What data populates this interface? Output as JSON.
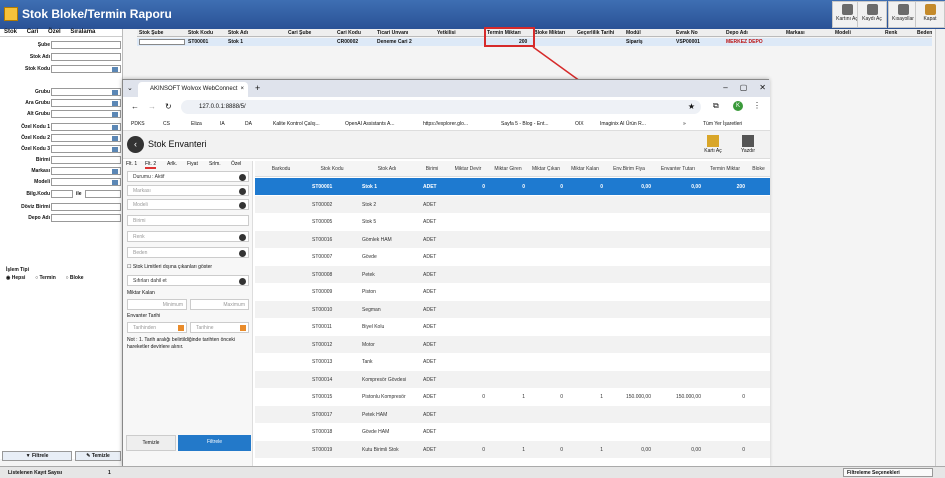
{
  "app": {
    "title": "Stok Bloke/Termin Raporu"
  },
  "toolbar": {
    "kartini_ac": "Kartını Aç",
    "kaydi_ac": "Kaydı Aç",
    "kisayollar": "Kısayollar",
    "kapat": "Kapat"
  },
  "left_panel": {
    "tabs": [
      "Stok",
      "Cari",
      "Özel",
      "Sıralama"
    ],
    "fields": [
      "Şube",
      "Stok Adı",
      "Stok Kodu",
      "Grubu",
      "Ara Grubu",
      "Alt Grubu",
      "Özel Kodu 1",
      "Özel Kodu 2",
      "Özel Kodu 3",
      "Birimi",
      "Markası",
      "Modeli",
      "Bilg.Kodu",
      "Döviz Birimi",
      "Depo Adı"
    ],
    "ile_label": "ile",
    "islem_tipi_label": "İşlem Tipi",
    "radio": [
      "Hepsi",
      "Termin",
      "Bloke"
    ],
    "filtrele": "Filtrele",
    "temizle": "Temizle"
  },
  "status": {
    "listed_label": "Listelenen Kayıt Sayısı",
    "listed_count": "1",
    "filtre_secenekleri": "Filtreleme Seçenekleri"
  },
  "grid": {
    "headers": [
      "Stok Şube",
      "Stok Kodu",
      "Stok Adı",
      "Cari Şube",
      "Cari Kodu",
      "Ticari Unvanı",
      "Yetkilisi",
      "Termin Miktarı",
      "Bloke Miktarı",
      "Geçerlilik Tarihi",
      "Modül",
      "Evrak No",
      "Depo Adı",
      "Markası",
      "Modeli",
      "Renk",
      "Beden"
    ],
    "row": {
      "stok_kodu": "ST00001",
      "stok_adi": "Stok 1",
      "cari_kodu": "CR00002",
      "ticari_unvan": "Deneme Cari 2",
      "termin_miktari": "200",
      "modul": "Sipariş",
      "evrak_no": "VSP00001",
      "depo_adi": "MERKEZ DEPO"
    }
  },
  "browser": {
    "tab_title": "AKINSOFT Wolvox WebConnect",
    "url": "127.0.0.1:8888/5/",
    "profile_initial": "K",
    "bookmarks": [
      "PDKS",
      "CS",
      "Eliza",
      "IA",
      "DA",
      "Kalite Kontrol Çalış...",
      "OpenAI Assistants A...",
      "https://explorer.glo...",
      "Sayfa 5 - Blog - Ent...",
      "OIX",
      "Imaginix AI Ürün R..."
    ],
    "all_bookmarks": "Tüm Yer İşaretleri"
  },
  "page": {
    "title": "Stok Envanteri",
    "kartini_ac": "Kartı Aç",
    "yazdir": "Yazdır",
    "filter_tabs": [
      "Flt. 1",
      "Flt. 2",
      "Arlk.",
      "Fiyat",
      "Srlm.",
      "Özel"
    ],
    "dropdowns": [
      "Durumu : Aktif",
      "Markası",
      "Modeli",
      "Birimi",
      "Renk",
      "Beden"
    ],
    "checkbox_label": "Stok Limitleri dışına çıkanları göster",
    "sifirlar": "Sıfırları dahil et",
    "miktar_kalan": "Miktar Kalan",
    "minimum": "Minimum",
    "maximum": "Maximum",
    "envanter_tarihi": "Envanter Tarihi",
    "tarihinden": "Tarihinden",
    "tarihine": "Tarihine",
    "note": "Not : 1. Tarih aralığı belirtildiğinde tarihten önceki hareketler devirlere alınır.",
    "temizle": "Temizle",
    "filtrele": "Filtrele",
    "columns": [
      "Barkodu",
      "Stok Kodu",
      "Stok Adı",
      "Birimi",
      "Miktar Devir",
      "Miktar Giren",
      "Miktar Çıkan",
      "Miktar Kalan",
      "Env.Birim Fiya",
      "Envanter Tutarı",
      "Termin Miktar",
      "Bloke"
    ],
    "rows": [
      {
        "kod": "ST00001",
        "ad": "Stok 1",
        "birim": "ADET",
        "devir": "0",
        "giren": "0",
        "cikan": "0",
        "kalan": "0",
        "fiyat": "0,00",
        "tutar": "0,00",
        "termin": "200"
      },
      {
        "kod": "ST00002",
        "ad": "Stok 2",
        "birim": "ADET"
      },
      {
        "kod": "ST00005",
        "ad": "Stok 5",
        "birim": "ADET"
      },
      {
        "kod": "ST00016",
        "ad": "Gömlek HAM",
        "birim": "ADET"
      },
      {
        "kod": "ST00007",
        "ad": "Gövde",
        "birim": "ADET"
      },
      {
        "kod": "ST00008",
        "ad": "Petek",
        "birim": "ADET"
      },
      {
        "kod": "ST00009",
        "ad": "Piston",
        "birim": "ADET"
      },
      {
        "kod": "ST00010",
        "ad": "Segman",
        "birim": "ADET"
      },
      {
        "kod": "ST00011",
        "ad": "Biyel Kolu",
        "birim": "ADET"
      },
      {
        "kod": "ST00012",
        "ad": "Motor",
        "birim": "ADET"
      },
      {
        "kod": "ST00013",
        "ad": "Tank",
        "birim": "ADET"
      },
      {
        "kod": "ST00014",
        "ad": "Kompresör Gövdesi",
        "birim": "ADET"
      },
      {
        "kod": "ST00015",
        "ad": "Pistonlu Kompresör",
        "birim": "ADET",
        "devir": "0",
        "giren": "1",
        "cikan": "0",
        "kalan": "1",
        "fiyat": "150.000,00",
        "tutar": "150.000,00",
        "termin": "0"
      },
      {
        "kod": "ST00017",
        "ad": "Petek HAM",
        "birim": "ADET"
      },
      {
        "kod": "ST00018",
        "ad": "Gövde HAM",
        "birim": "ADET"
      },
      {
        "kod": "ST00019",
        "ad": "Kutu Birimli Stok",
        "birim": "ADET",
        "devir": "0",
        "giren": "1",
        "cikan": "0",
        "kalan": "1",
        "fiyat": "0,00",
        "tutar": "0,00",
        "termin": "0"
      }
    ]
  },
  "colors": {
    "accent": "#2a5296",
    "highlight": "#d62a2a",
    "selected_row": "#1e7ad0"
  }
}
